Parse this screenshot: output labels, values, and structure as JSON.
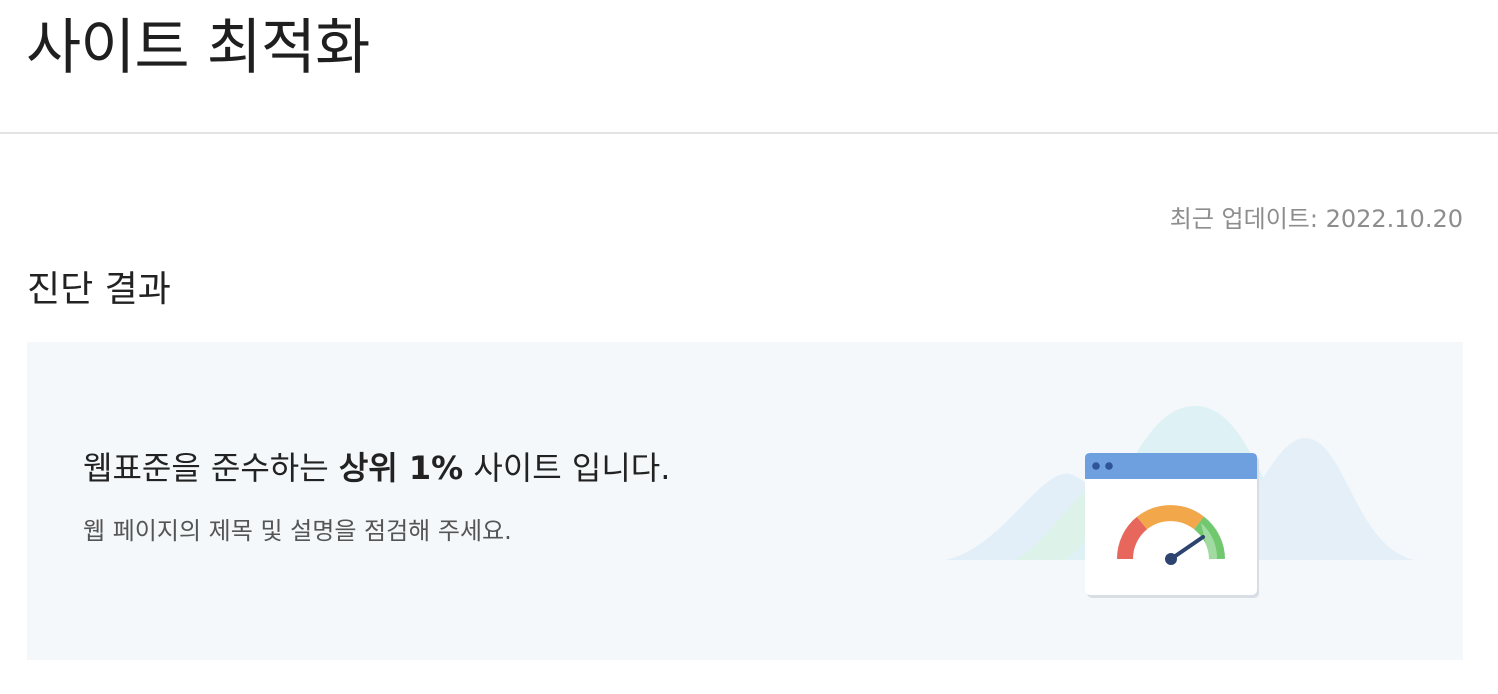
{
  "header": {
    "title": "사이트 최적화"
  },
  "meta": {
    "updated_text": "최근 업데이트: 2022.10.20"
  },
  "section": {
    "title": "진단 결과"
  },
  "result": {
    "headline_prefix": "웹표준을 준수하는 ",
    "headline_strong": "상위 1%",
    "headline_suffix": " 사이트 입니다.",
    "subtext": "웹 페이지의 제목 및 설명을 점검해 주세요."
  },
  "illustration": {
    "icon": "browser-speed-gauge-icon",
    "gauge_colors": [
      "#e8675d",
      "#f2a84a",
      "#71c86f"
    ],
    "window_bar_color": "#6ea0e0"
  }
}
